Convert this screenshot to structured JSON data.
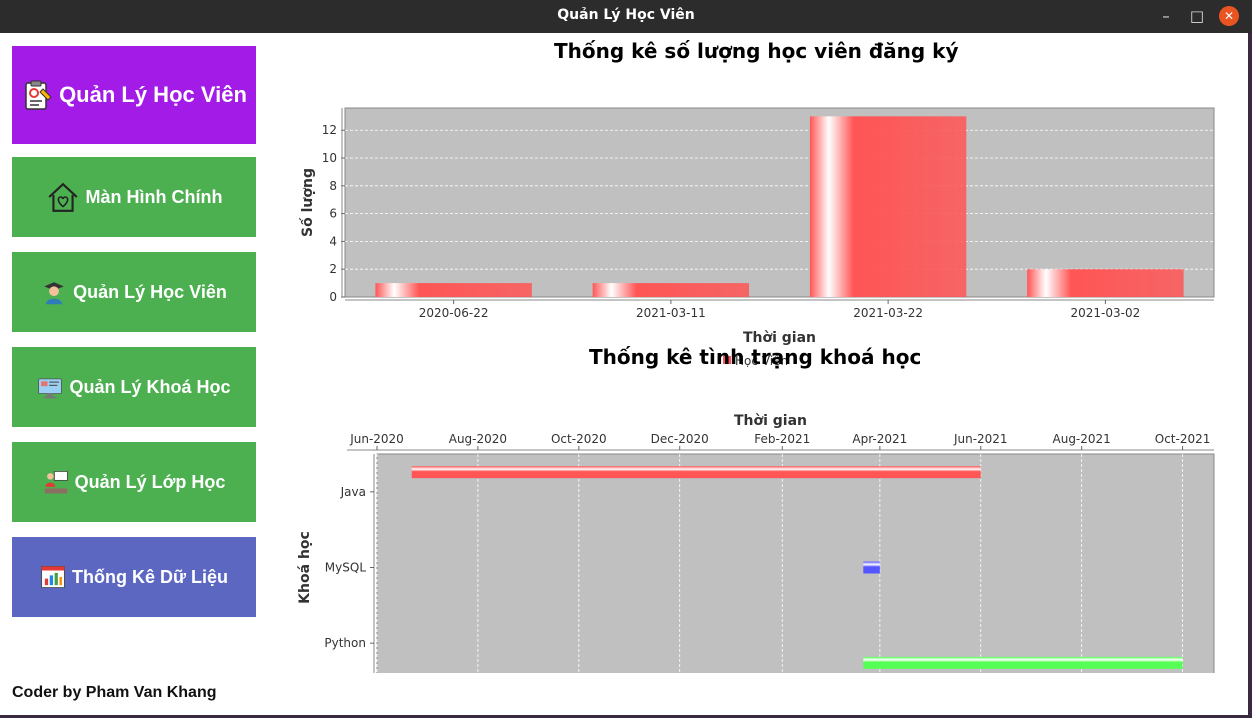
{
  "window": {
    "title": "Quản Lý Học Viên",
    "minimize_glyph": "–",
    "maximize_glyph": "□",
    "close_glyph": "✕"
  },
  "sidebar": {
    "items": [
      {
        "label": "Quản Lý Học Viên",
        "icon": "clipboard-icon",
        "color": "#a31be6"
      },
      {
        "label": "Màn Hình Chính",
        "icon": "home-icon",
        "color": "#4caf50"
      },
      {
        "label": "Quản Lý Học Viên",
        "icon": "graduate-icon",
        "color": "#4caf50"
      },
      {
        "label": "Quản Lý Khoá Học",
        "icon": "monitor-icon",
        "color": "#4caf50"
      },
      {
        "label": "Quản Lý Lớp Học",
        "icon": "classroom-icon",
        "color": "#4caf50"
      },
      {
        "label": "Thống Kê Dữ Liệu",
        "icon": "chart-icon",
        "color": "#5c67c2"
      }
    ],
    "footer": "Coder by Pham Van Khang"
  },
  "chart_data": [
    {
      "type": "bar",
      "title": "Thống kê số lượng học viên đăng ký",
      "xlabel": "Thời gian",
      "ylabel": "Số lượng",
      "categories": [
        "2020-06-22",
        "2021-03-11",
        "2021-03-22",
        "2021-03-02"
      ],
      "series": [
        {
          "name": "Học Viên",
          "values": [
            1,
            1,
            13,
            2
          ],
          "color": "#ff5555"
        }
      ],
      "ylim": [
        0,
        13.6
      ],
      "yticks": [
        0,
        2,
        4,
        6,
        8,
        10,
        12
      ],
      "grid": true,
      "legend": "bottom"
    },
    {
      "type": "gantt",
      "title": "Thống kê tình trạng khoá học",
      "xlabel": "Thời gian",
      "ylabel": "Khoá học",
      "x_axis_position": "top",
      "xlim": [
        "2020-06-01",
        "2021-10-20"
      ],
      "xticks": [
        "Jun-2020",
        "Aug-2020",
        "Oct-2020",
        "Dec-2020",
        "Feb-2021",
        "Apr-2021",
        "Jun-2021",
        "Aug-2021",
        "Oct-2021"
      ],
      "tick_dates": [
        "2020-06-01",
        "2020-08-01",
        "2020-10-01",
        "2020-12-01",
        "2021-02-01",
        "2021-04-01",
        "2021-06-01",
        "2021-08-01",
        "2021-10-01"
      ],
      "categories": [
        "Java",
        "MySQL",
        "Python"
      ],
      "series": [
        {
          "name": "Java",
          "start": "2020-06-22",
          "end": "2021-06-01",
          "color": "#ff5555"
        },
        {
          "name": "MySQL",
          "start": "2021-03-22",
          "end": "2021-04-01",
          "color": "#5555ff"
        },
        {
          "name": "Python",
          "start": "2021-03-22",
          "end": "2021-10-01",
          "color": "#55ff55"
        }
      ],
      "grid": true,
      "legend": "bottom"
    }
  ]
}
